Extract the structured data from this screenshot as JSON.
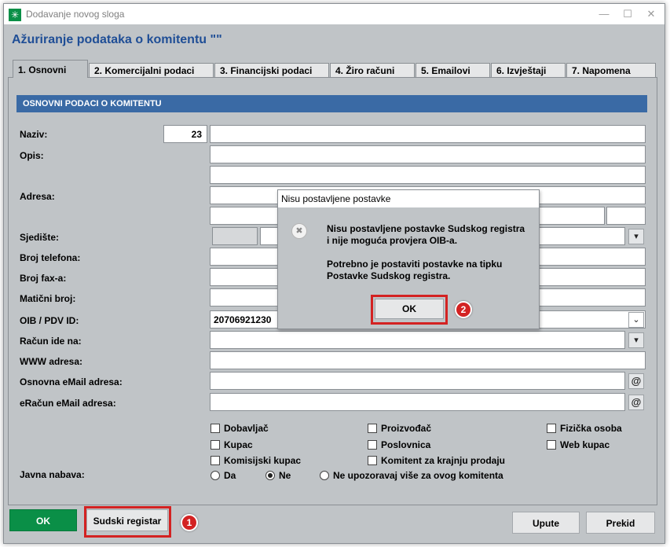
{
  "window": {
    "title": "Dodavanje novog sloga"
  },
  "heading": "Ažuriranje podataka o komitentu \"\"",
  "tabs": [
    {
      "label": "1. Osnovni"
    },
    {
      "label": "2. Komercijalni podaci"
    },
    {
      "label": "3. Financijski podaci"
    },
    {
      "label": "4. Žiro računi"
    },
    {
      "label": "5. Emailovi"
    },
    {
      "label": "6. Izvještaji"
    },
    {
      "label": "7. Napomena"
    }
  ],
  "section_title": "OSNOVNI PODACI O KOMITENTU",
  "labels": {
    "naziv": "Naziv:",
    "opis": "Opis:",
    "adresa": "Adresa:",
    "sjediste": "Sjedište:",
    "telefon": "Broj telefona:",
    "fax": "Broj fax-a:",
    "maticni": "Matični broj:",
    "oib": "OIB / PDV ID:",
    "racun_ide": "Račun ide na:",
    "www": "WWW adresa:",
    "email": "Osnovna eMail adresa:",
    "eracun_email": "eRačun eMail adresa:",
    "javna_nabava": "Javna nabava:"
  },
  "values": {
    "naziv_code": "23",
    "oib": "20706921230"
  },
  "icons": {
    "dropdown": "▾",
    "at": "@",
    "chevron": "⌄"
  },
  "checkboxes": {
    "dobavljac": "Dobavljač",
    "kupac": "Kupac",
    "komisijski": "Komisijski kupac",
    "proizvodac": "Proizvođač",
    "poslovnica": "Poslovnica",
    "komitent_krajnja": "Komitent za krajnju prodaju",
    "fizicka": "Fizička osoba",
    "web_kupac": "Web kupac"
  },
  "radios": {
    "da": "Da",
    "ne": "Ne",
    "ne_upozoravaj": "Ne upozoravaj više za ovog komitenta",
    "selected": "Ne"
  },
  "buttons": {
    "ok": "OK",
    "sudski": "Sudski registar",
    "upute": "Upute",
    "prekid": "Prekid"
  },
  "dialog": {
    "title": "Nisu postavljene postavke",
    "line1": "Nisu postavljene postavke Sudskog registra",
    "line2": "i nije moguća provjera OIB-a.",
    "line3": "Potrebno je postaviti postavke na tipku",
    "line4": "Postavke Sudskog registra.",
    "ok": "OK"
  },
  "annotations": {
    "step1": "1",
    "step2": "2"
  },
  "colors": {
    "accent": "#1f4e96",
    "section": "#3a6aa5",
    "ok_green": "#0a8f47",
    "highlight": "#d32222"
  }
}
